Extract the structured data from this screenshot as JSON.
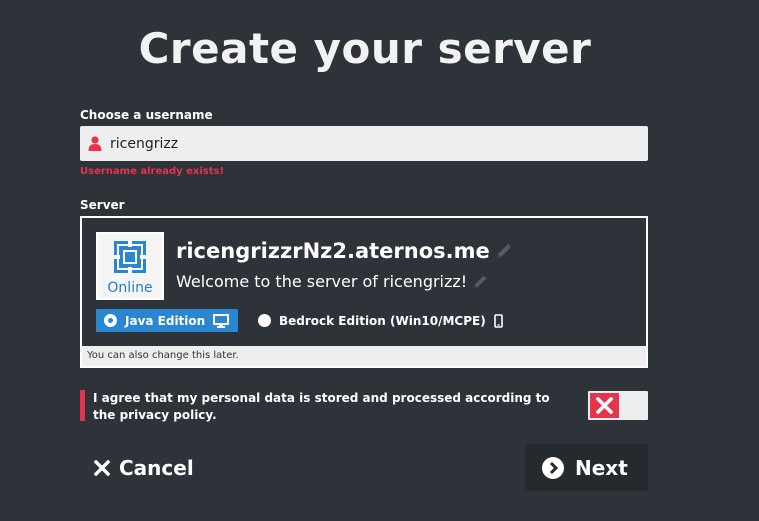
{
  "page": {
    "title": "Create your server"
  },
  "username": {
    "label": "Choose a username",
    "value": "ricengrizz",
    "error": "Username already exists!"
  },
  "server": {
    "label": "Server",
    "status": "Online",
    "address": "ricengrizzrNz2.aternos.me",
    "motd": "Welcome to the server of ricengrizz!",
    "editions": [
      {
        "label": "Java Edition",
        "selected": true,
        "icon": "monitor-icon"
      },
      {
        "label": "Bedrock Edition (Win10/MCPE)",
        "selected": false,
        "icon": "phone-icon"
      }
    ],
    "note": "You can also change this later."
  },
  "privacy": {
    "text": "I agree that my personal data is stored and processed according to the privacy policy.",
    "agreed": false
  },
  "actions": {
    "cancel_label": "Cancel",
    "next_label": "Next"
  },
  "colors": {
    "background": "#2d3339",
    "accent_blue": "#2b86d1",
    "error_red": "#e8334d"
  }
}
